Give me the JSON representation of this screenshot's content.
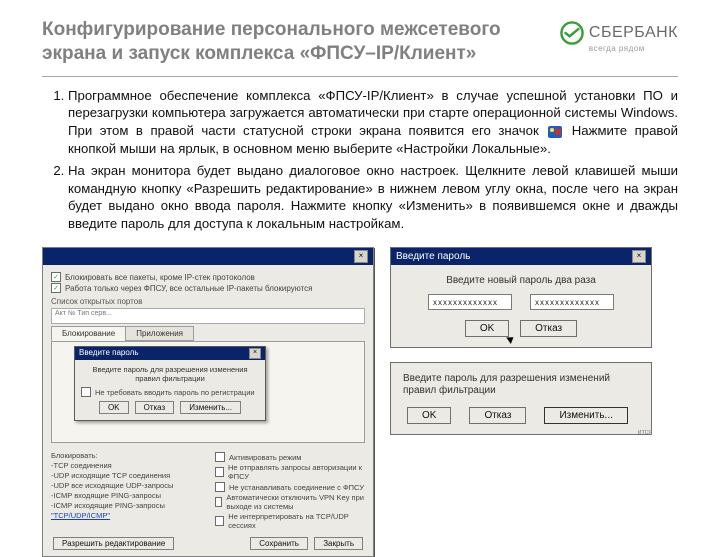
{
  "header": {
    "title": "Конфигурирование персонального межсетевого экрана и запуск комплекса «ФПСУ–IP/Клиент»",
    "logo_text": "СБЕРБАНК",
    "logo_tagline": "всегда рядом"
  },
  "list": {
    "item1_a": "Программное обеспечение комплекса «ФПСУ-IP/Клиент» в случае успешной установки ПО и перезагрузки компьютера загружается автоматически при старте операционной системы Windows. При этом в правой части статусной строки экрана появится его значок",
    "item1_b": "Нажмите правой кнопкой мыши на ярлык, в основном меню выберите «Настройки Локальные».",
    "item2": "На экран монитора будет выдано диалоговое окно настроек. Щелкните левой клавишей мыши командную кнопку «Разрешить редактирование» в нижнем левом углу окна, после чего на экран будет выдано окно ввода пароля. Нажмите кнопку «Изменить» в появившемся окне и дважды введите пароль для доступа к локальным настройкам."
  },
  "leftWin": {
    "chk1": "Блокировать все пакеты, кроме IP-стек протоколов",
    "chk2": "Работа только через ФПСУ, все остальные IP-пакеты блокируются",
    "sectionLabel": "Список открытых портов",
    "listPlaceholder": "Акт №   Тип серв...",
    "tab1": "Блокирование",
    "tab2": "Приложения",
    "innerTitle": "Введите пароль",
    "innerMsg": "Введите пароль для разрешения изменения правил фильтрации",
    "innerChk": "Не требовать вводить пароль по регистрации",
    "btnOk": "OK",
    "btnCancel": "Отказ",
    "btnChange": "Изменить...",
    "colA_head": "Блокировать:",
    "colA_1": "-TCP соединения",
    "colA_2": "-UDP исходящие TCP соединения",
    "colA_3": "-UDP все исходящие UDP-запросы",
    "colA_4": "-ICMP вxодящие PING-запросы",
    "colA_5": "-ICMP исходящие PING-запросы",
    "colA_link": "\"TCP/UDP/ICMP\"",
    "colB_1": "Активировать режим",
    "colB_2": "Не отправлять запросы авторизации к ФПСУ",
    "colB_3": "Не устанавливать соединение с ФПСУ",
    "colB_4": "Автоматически отключить VPN Key при выходе из системы",
    "colB_5": "Не интерпретировать на TCP/UDP сессиях",
    "btnAllow": "Разрешить редактирование",
    "btnSave": "Сохранить",
    "btnClose": "Закрыть"
  },
  "dlgPw": {
    "title": "Введите пароль",
    "hint": "Введите новый пароль два раза",
    "masked": "xxxxxxxxxxxxx",
    "ok": "OK",
    "cancel": "Отказ"
  },
  "dlgFilter": {
    "msg": "Введите пароль для разрешения изменений правил фильтрации",
    "ok": "OK",
    "cancel": "Отказ",
    "change": "Изменить...",
    "sideText": "ится"
  }
}
